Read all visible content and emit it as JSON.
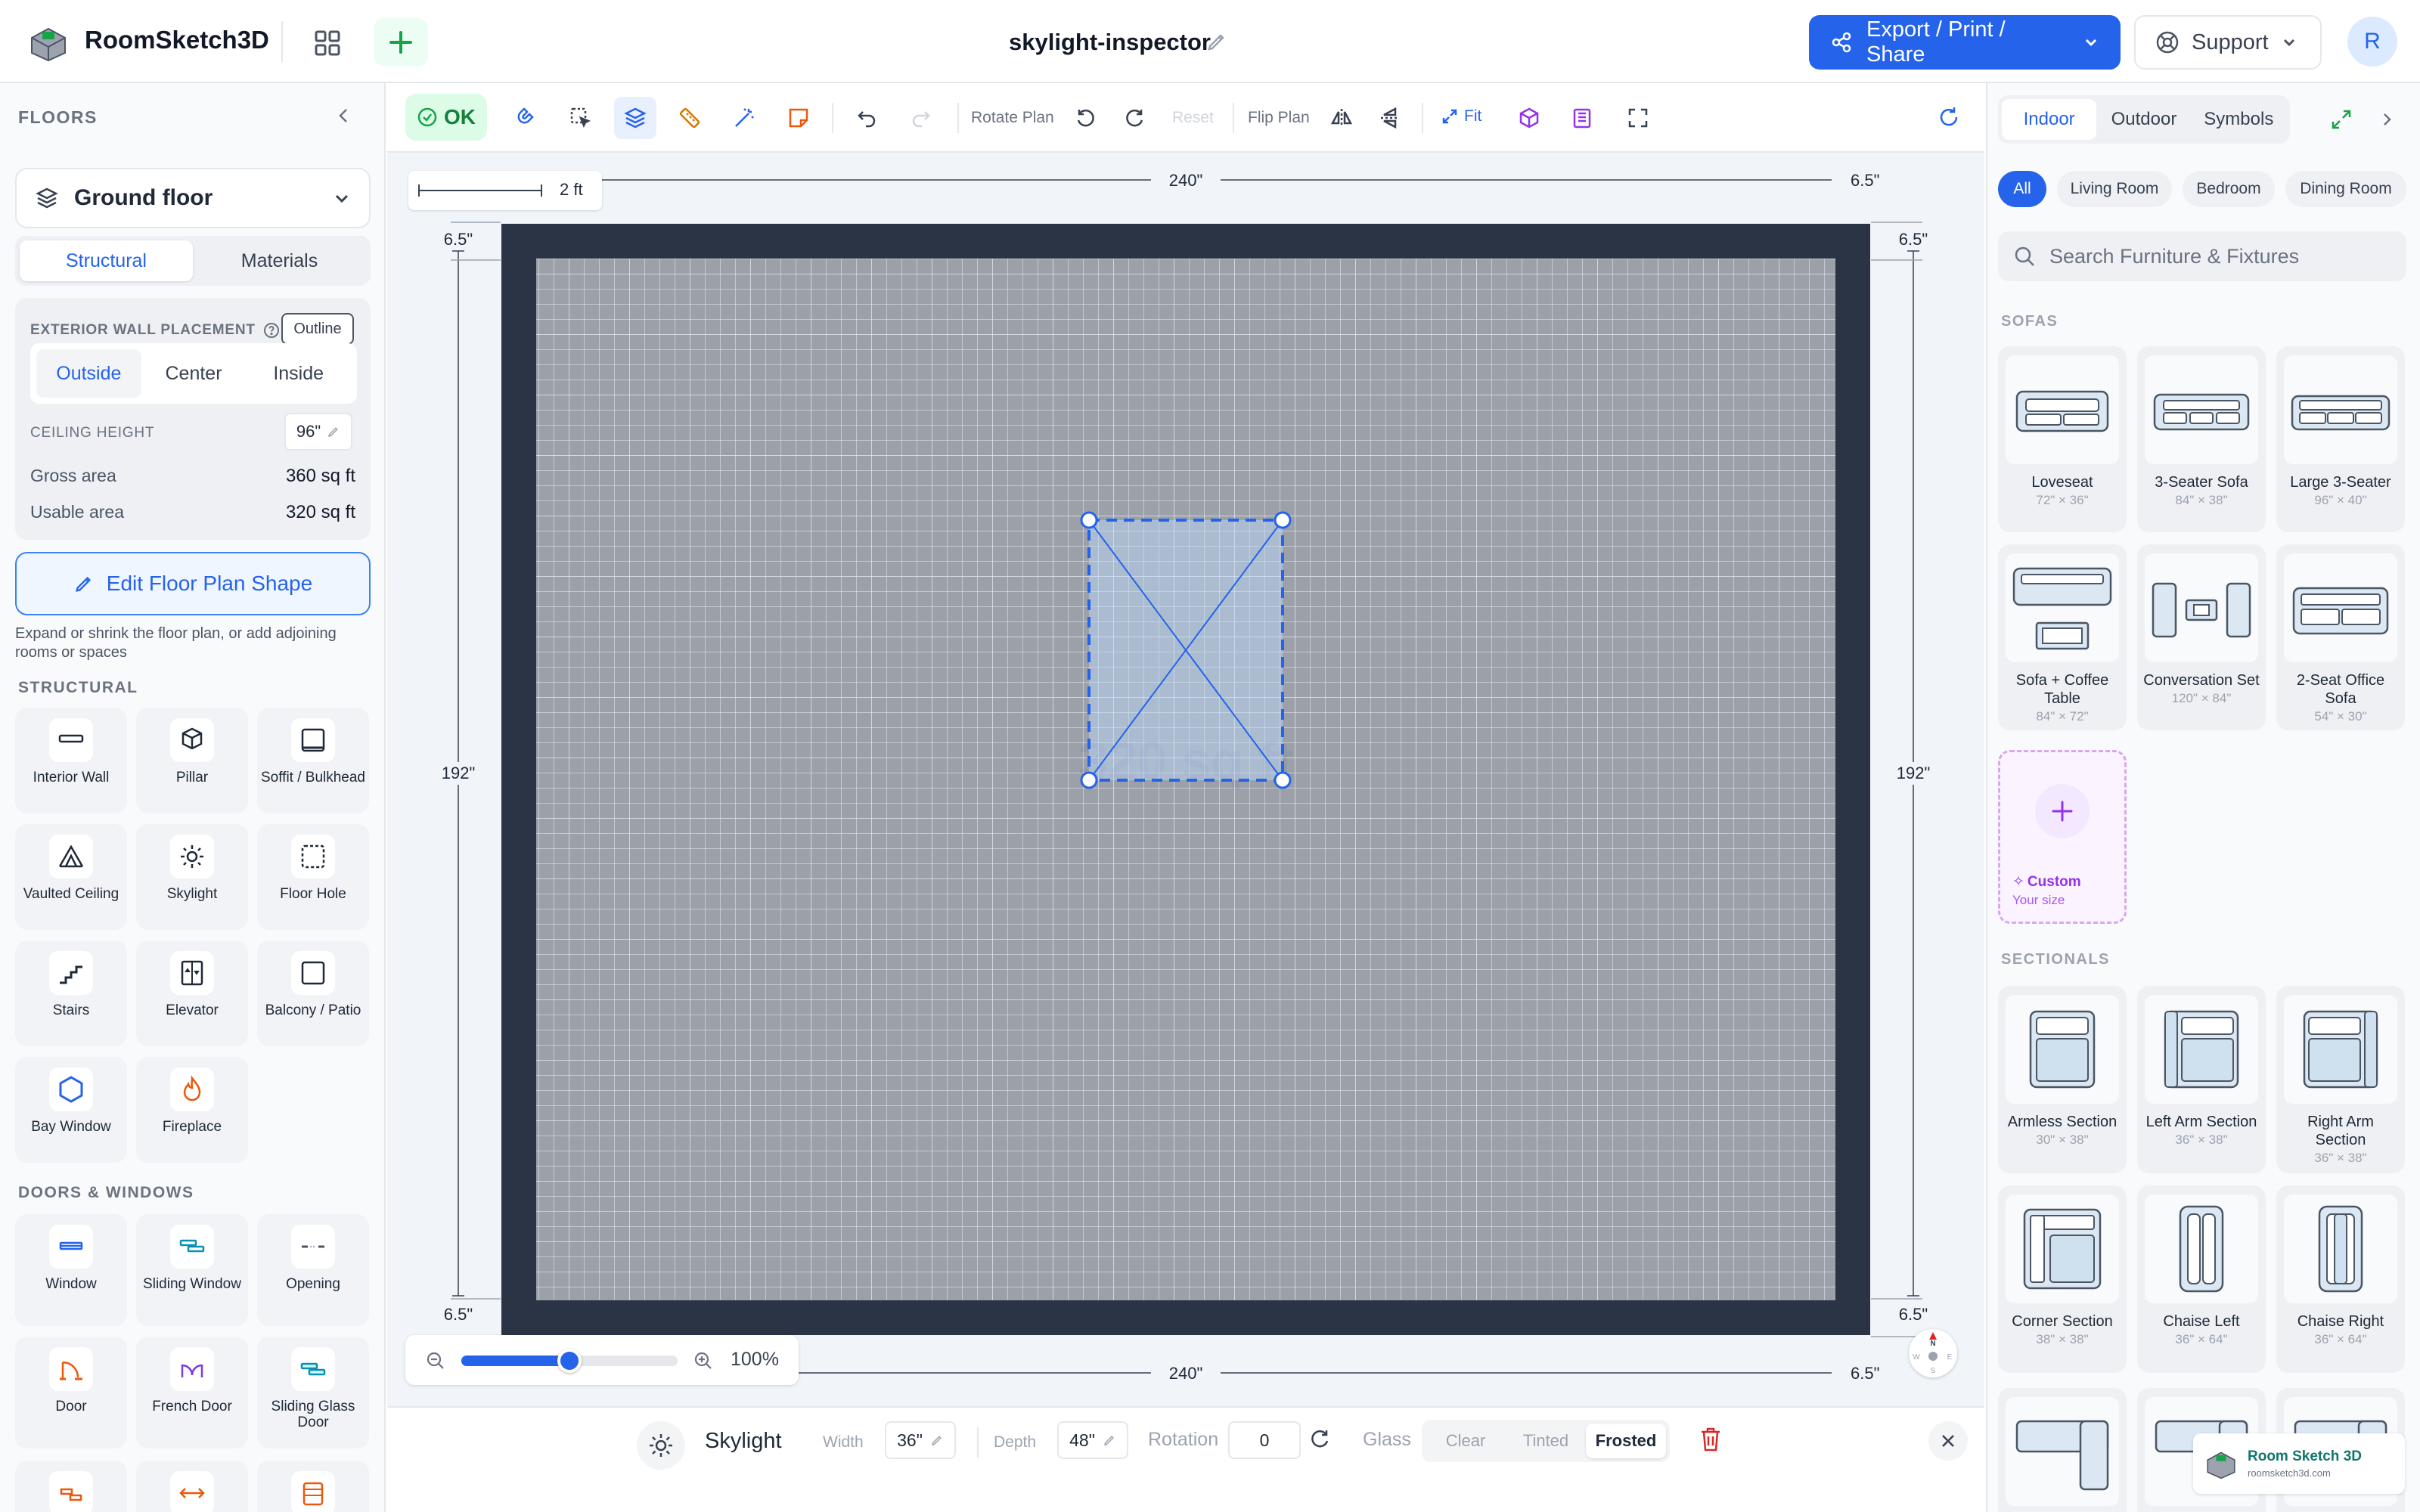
{
  "header": {
    "app_name": "RoomSketch3D",
    "doc_title": "skylight-inspector",
    "export_label": "Export / Print / Share",
    "support_label": "Support",
    "avatar_initial": "R"
  },
  "left": {
    "floors_label": "FLOORS",
    "floor_selected": "Ground floor",
    "tabs": [
      "Structural",
      "Materials"
    ],
    "active_tab": "Structural",
    "wall_placement_label": "EXTERIOR WALL PLACEMENT",
    "outline_label": "Outline",
    "placement_options": [
      "Outside",
      "Center",
      "Inside"
    ],
    "placement_active": "Outside",
    "ceiling_label": "CEILING HEIGHT",
    "ceiling_value": "96\"",
    "gross_label": "Gross area",
    "gross_value": "360 sq ft",
    "usable_label": "Usable area",
    "usable_value": "320 sq ft",
    "edit_shape_label": "Edit Floor Plan Shape",
    "edit_shape_hint": "Expand or shrink the floor plan, or add adjoining rooms or spaces",
    "structural_label": "STRUCTURAL",
    "structural_items": [
      {
        "label": "Interior Wall",
        "icon": "interior-wall-icon"
      },
      {
        "label": "Pillar",
        "icon": "pillar-icon"
      },
      {
        "label": "Soffit / Bulkhead",
        "icon": "soffit-icon"
      },
      {
        "label": "Vaulted Ceiling",
        "icon": "vaulted-ceiling-icon"
      },
      {
        "label": "Skylight",
        "icon": "skylight-icon"
      },
      {
        "label": "Floor Hole",
        "icon": "floor-hole-icon"
      },
      {
        "label": "Stairs",
        "icon": "stairs-icon"
      },
      {
        "label": "Elevator",
        "icon": "elevator-icon"
      },
      {
        "label": "Balcony / Patio",
        "icon": "balcony-icon"
      },
      {
        "label": "Bay Window",
        "icon": "bay-window-icon"
      },
      {
        "label": "Fireplace",
        "icon": "fireplace-icon"
      }
    ],
    "doors_label": "DOORS & WINDOWS",
    "door_items": [
      {
        "label": "Window",
        "icon": "window-icon"
      },
      {
        "label": "Sliding Window",
        "icon": "sliding-window-icon"
      },
      {
        "label": "Opening",
        "icon": "opening-icon"
      },
      {
        "label": "Door",
        "icon": "door-icon"
      },
      {
        "label": "French Door",
        "icon": "french-door-icon"
      },
      {
        "label": "Sliding Glass Door",
        "icon": "sliding-glass-door-icon"
      }
    ]
  },
  "toolbar": {
    "status": "OK",
    "rotate_label": "Rotate Plan",
    "reset_label": "Reset",
    "flip_label": "Flip Plan",
    "fit_label": "Fit"
  },
  "canvas": {
    "scale_label": "2 ft",
    "dim_top": "240\"",
    "dim_bottom": "240\"",
    "dim_left": "192\"",
    "dim_right": "192\"",
    "dim_wall": "6.5\"",
    "room_area_watermark": "320 sq ft",
    "zoom_percent": "100%",
    "zoom_level": 0.5,
    "compass": {
      "n": "N",
      "e": "E",
      "s": "S",
      "w": "W"
    }
  },
  "inspector": {
    "title": "Skylight",
    "width_label": "Width",
    "width_value": "36\"",
    "depth_label": "Depth",
    "depth_value": "48\"",
    "rotation_label": "Rotation",
    "rotation_value": "0",
    "glass_label": "Glass",
    "glass_options": [
      "Clear",
      "Tinted",
      "Frosted"
    ],
    "glass_active": "Frosted"
  },
  "right": {
    "tabs": [
      "Indoor",
      "Outdoor",
      "Symbols"
    ],
    "active_tab": "Indoor",
    "chips": [
      "All",
      "Living Room",
      "Bedroom",
      "Dining Room"
    ],
    "active_chip": "All",
    "search_placeholder": "Search Furniture & Fixtures",
    "sofas_label": "SOFAS",
    "sofas": [
      {
        "name": "Loveseat",
        "dims": "72\" × 36\""
      },
      {
        "name": "3-Seater Sofa",
        "dims": "84\" × 38\""
      },
      {
        "name": "Large 3-Seater",
        "dims": "96\" × 40\""
      },
      {
        "name": "Sofa + Coffee Table",
        "dims": "84\" × 72\""
      },
      {
        "name": "Conversation Set",
        "dims": "120\" × 84\""
      },
      {
        "name": "2-Seat Office Sofa",
        "dims": "54\" × 30\""
      }
    ],
    "custom_title": "Custom",
    "custom_sub": "Your size",
    "sectionals_label": "SECTIONALS",
    "sectionals": [
      {
        "name": "Armless Section",
        "dims": "30\" × 38\""
      },
      {
        "name": "Left Arm Section",
        "dims": "36\" × 38\""
      },
      {
        "name": "Right Arm Section",
        "dims": "36\" × 38\""
      },
      {
        "name": "Corner Section",
        "dims": "38\" × 38\""
      },
      {
        "name": "Chaise Left",
        "dims": "36\" × 64\""
      },
      {
        "name": "Chaise Right",
        "dims": "36\" × 64\""
      }
    ],
    "watermark_title": "Room Sketch 3D",
    "watermark_url": "roomsketch3d.com"
  },
  "colors": {
    "accent": "#2563eb",
    "wall": "#2b3445",
    "ok": "#16a34a",
    "custom": "#9333ea"
  }
}
